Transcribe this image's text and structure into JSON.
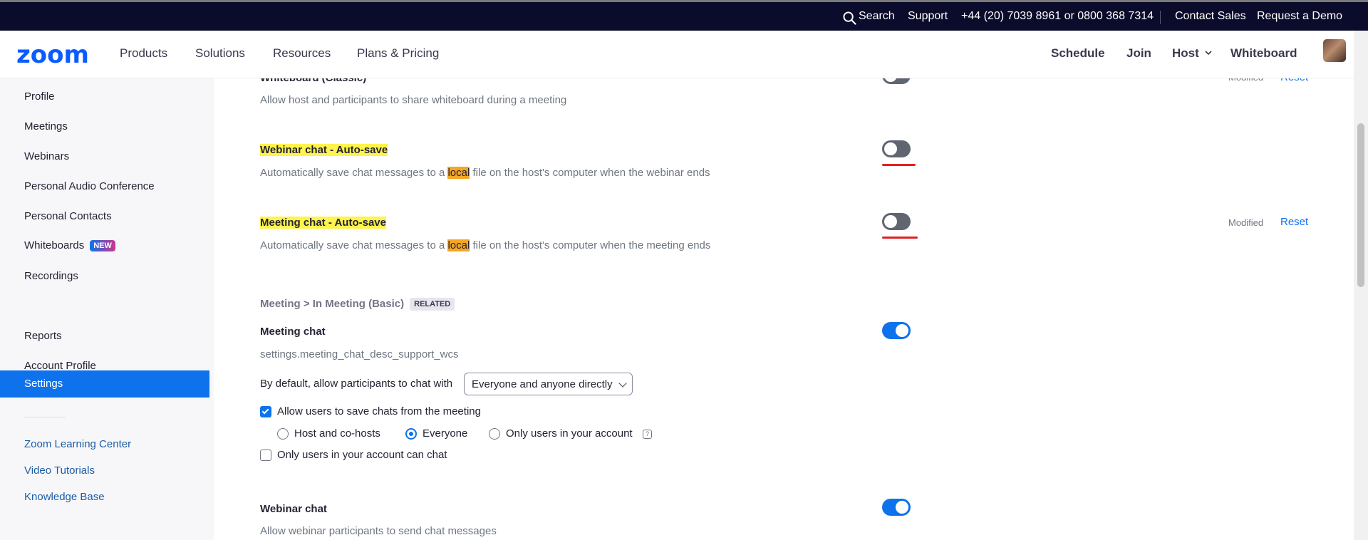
{
  "topbar": {
    "search": "Search",
    "support": "Support",
    "phone": "+44 (20) 7039 8961 or 0800 368 7314",
    "contact_sales": "Contact Sales",
    "request_demo": "Request a Demo"
  },
  "nav": {
    "logo": "zoom",
    "products": "Products",
    "solutions": "Solutions",
    "resources": "Resources",
    "plans": "Plans & Pricing",
    "schedule": "Schedule",
    "join": "Join",
    "host": "Host",
    "whiteboard": "Whiteboard"
  },
  "sidebar": {
    "items": [
      "Profile",
      "Meetings",
      "Webinars",
      "Personal Audio Conference",
      "Personal Contacts",
      "Whiteboards",
      "Recordings",
      "Settings",
      "Reports",
      "Account Profile"
    ],
    "new_badge": "NEW",
    "active": "Settings",
    "links": [
      "Zoom Learning Center",
      "Video Tutorials",
      "Knowledge Base"
    ]
  },
  "content": {
    "partial_title": "Whiteboard (Classic)",
    "partial_modified": "Modified",
    "partial_reset": "Reset",
    "partial_desc": "Allow host and participants to share whiteboard during a meeting",
    "webinar_autosave": {
      "title": "Webinar chat - Auto-save",
      "desc_pre": "Automatically save chat messages to a ",
      "desc_hl": "local",
      "desc_post": " file on the host's computer when the webinar ends",
      "enabled": false
    },
    "meeting_autosave": {
      "title": "Meeting chat - Auto-save",
      "desc_pre": "Automatically save chat messages to a ",
      "desc_hl": "local",
      "desc_post": " file on the host's computer when the meeting ends",
      "enabled": false,
      "modified": "Modified",
      "reset": "Reset"
    },
    "section_path": "Meeting > In Meeting (Basic)",
    "related_badge": "RELATED",
    "meeting_chat": {
      "title": "Meeting chat",
      "desc": "settings.meeting_chat_desc_support_wcs",
      "enabled": true,
      "default_label": "By default, allow participants to chat with",
      "default_value": "Everyone and anyone directly",
      "allow_save_label": "Allow users to save chats from the meeting",
      "allow_save_checked": true,
      "radio_options": [
        "Host and co-hosts",
        "Everyone",
        "Only users in your account"
      ],
      "radio_selected": "Everyone",
      "only_account_label": "Only users in your account can chat",
      "only_account_checked": false
    },
    "webinar_chat": {
      "title": "Webinar chat",
      "desc": "Allow webinar participants to send chat messages",
      "enabled": true
    }
  },
  "colors": {
    "brand": "#0b5cff",
    "accent": "#0e72ed",
    "topbar": "#0b0b2b",
    "highlight": "#fff34d",
    "highlight_local": "#f5a623",
    "annotation": "#e02020"
  }
}
